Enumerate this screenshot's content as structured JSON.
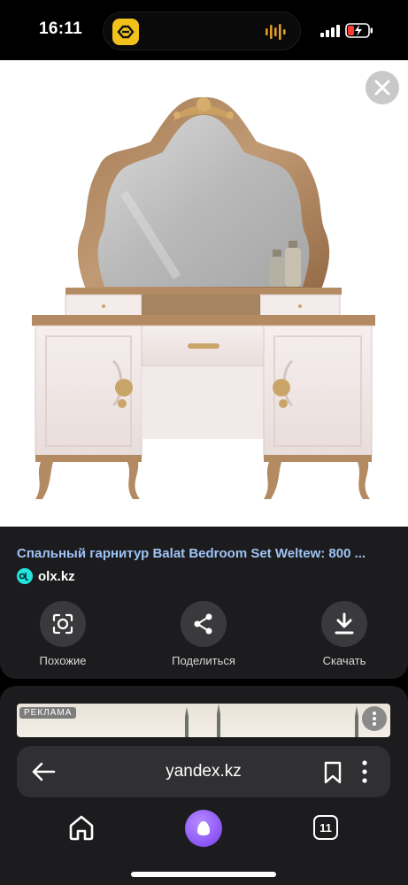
{
  "status_bar": {
    "time": "16:11",
    "icons": [
      "app-activity-icon",
      "audio-wave-icon",
      "signal-icon",
      "battery-charging-icon"
    ]
  },
  "viewer": {
    "close_icon": "close-icon",
    "image_subject": "dressing-table-with-mirror"
  },
  "result": {
    "title": "Спальный гарнитур Balat Bedroom Set Weltew: 800 ...",
    "source": "olx.kz"
  },
  "actions": [
    {
      "label": "Похожие",
      "icon": "lens-search-icon"
    },
    {
      "label": "Поделиться",
      "icon": "share-icon"
    },
    {
      "label": "Скачать",
      "icon": "download-icon"
    }
  ],
  "ad": {
    "badge": "РЕКЛАМА"
  },
  "browser": {
    "url": "yandex.kz",
    "tabs_count": "11"
  },
  "colors": {
    "link_blue": "#9ec3f5",
    "card_bg": "#1c1c1e",
    "olx_accent": "#23e5db",
    "alice_purple": "#8a4dff"
  }
}
